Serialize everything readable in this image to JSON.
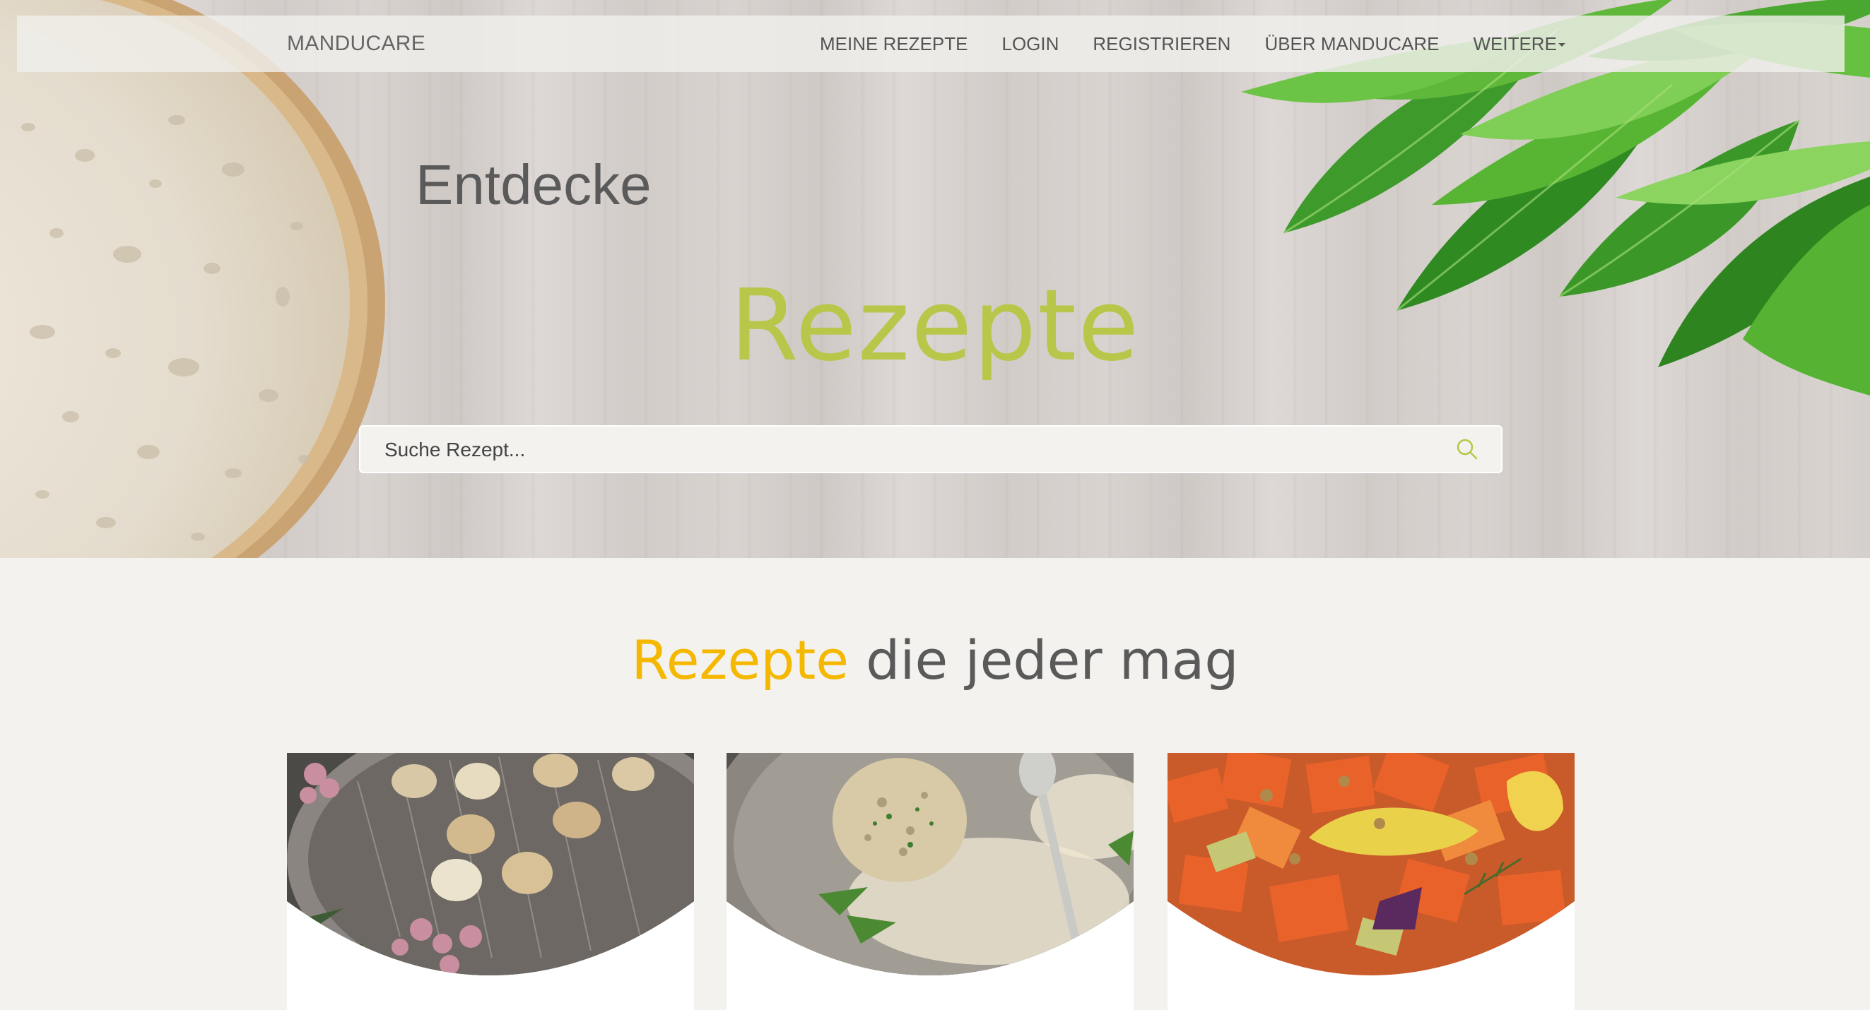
{
  "navbar": {
    "brand": "MANDUCARE",
    "items": [
      {
        "label": "MEINE REZEPTE"
      },
      {
        "label": "LOGIN"
      },
      {
        "label": "REGISTRIEREN"
      },
      {
        "label": "ÜBER MANDUCARE"
      },
      {
        "label": "WEITERE"
      }
    ]
  },
  "hero": {
    "subtitle": "Entdecke",
    "title": "Rezepte",
    "search_placeholder": "Suche Rezept..."
  },
  "section": {
    "title_accent": "Rezepte",
    "title_rest": " die jeder mag"
  },
  "colors": {
    "title_green": "#b8c64a",
    "accent_yellow": "#f5b800",
    "background": "#f3f2ef"
  },
  "icons": {
    "search": "search-icon",
    "dropdown": "caret-down-icon"
  }
}
